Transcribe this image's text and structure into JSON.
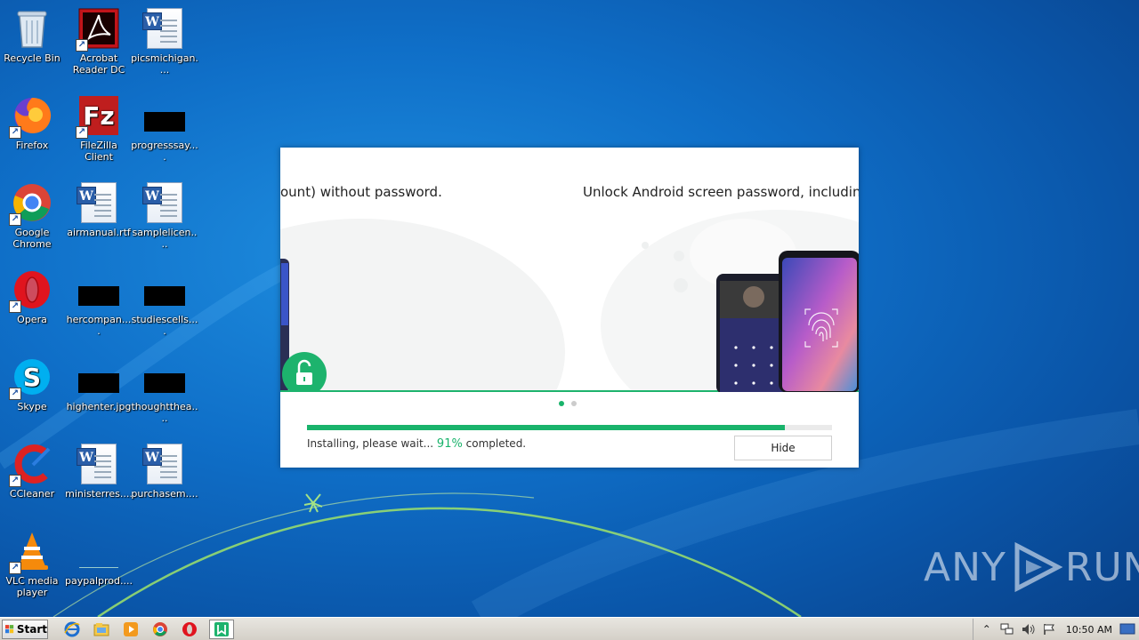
{
  "desktop": {
    "icons": [
      {
        "label": "Recycle Bin",
        "icon": "recycle-bin-icon"
      },
      {
        "label": "Acrobat Reader DC",
        "icon": "acrobat-icon"
      },
      {
        "label": "picsmichigan....",
        "icon": "word-doc-icon"
      },
      {
        "label": "Firefox",
        "icon": "firefox-icon"
      },
      {
        "label": "FileZilla Client",
        "icon": "filezilla-icon"
      },
      {
        "label": "progresssay....",
        "icon": "blank-file-icon"
      },
      {
        "label": "Google Chrome",
        "icon": "chrome-icon"
      },
      {
        "label": "airmanual.rtf",
        "icon": "word-doc-icon"
      },
      {
        "label": "samplelicen....",
        "icon": "word-doc-icon"
      },
      {
        "label": "Opera",
        "icon": "opera-icon"
      },
      {
        "label": "hercompan....",
        "icon": "blank-file-icon"
      },
      {
        "label": "studiescells....",
        "icon": "blank-file-icon"
      },
      {
        "label": "Skype",
        "icon": "skype-icon"
      },
      {
        "label": "highenter.jpg",
        "icon": "blank-file-icon"
      },
      {
        "label": "thoughtthea....",
        "icon": "blank-file-icon"
      },
      {
        "label": "CCleaner",
        "icon": "ccleaner-icon"
      },
      {
        "label": "ministerres....",
        "icon": "word-doc-icon"
      },
      {
        "label": "purchasem....",
        "icon": "word-doc-icon"
      },
      {
        "label": "VLC media player",
        "icon": "vlc-icon"
      },
      {
        "label": "paypalprod....",
        "icon": "blank-file-icon"
      }
    ]
  },
  "installer": {
    "banner_left_text": "ount) without password.",
    "banner_right_text": "Unlock Android screen password, includin",
    "progress_percent": 91,
    "status_prefix": "Installing, please wait... ",
    "status_percent": "91%",
    "status_suffix": " completed.",
    "hide_label": "Hide",
    "accent": "#19b36b"
  },
  "watermark": {
    "text_left": "ANY",
    "text_right": "RUN"
  },
  "taskbar": {
    "start_label": "Start",
    "clock": "10:50 AM"
  }
}
